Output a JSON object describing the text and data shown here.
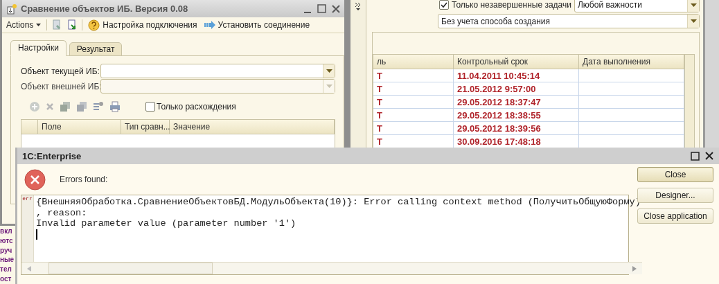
{
  "background_window": {
    "filter_checkbox": {
      "label": "Только незавершенные задачи",
      "checked": true
    },
    "importance_select": {
      "value": "Любой важности"
    },
    "creation_select": {
      "value": "Без учета способа создания"
    },
    "table": {
      "columns": [
        "ль",
        "Контрольный срок",
        "Дата выполнения"
      ],
      "rows": [
        {
          "cells": [
            "Т",
            "11.04.2011 10:45:14"
          ]
        },
        {
          "cells": [
            "Т",
            "21.05.2012 9:57:00"
          ]
        },
        {
          "cells": [
            "Т",
            "29.05.2012 18:37:47"
          ]
        },
        {
          "cells": [
            "Т",
            "29.05.2012 18:38:55"
          ]
        },
        {
          "cells": [
            "Т",
            "29.05.2012 18:39:56"
          ]
        },
        {
          "cells": [
            "Т",
            "30.09.2016 17:48:18"
          ]
        }
      ]
    }
  },
  "background_text": [
    "вкл",
    "ютс",
    "руч",
    "ные",
    "тел",
    "ост"
  ],
  "compare_window": {
    "title": "Сравнение объектов ИБ. Версия 0.08",
    "toolbar": {
      "actions_menu": "Actions",
      "buttons": [
        {
          "kind": "help",
          "label": "Настройка подключения"
        },
        {
          "kind": "connect",
          "label": "Установить соединение"
        }
      ]
    },
    "tabs": [
      {
        "label": "Настройки",
        "selected": true
      },
      {
        "label": "Результат",
        "selected": false
      }
    ],
    "fields": [
      {
        "label": "Объект текущей ИБ:",
        "disabled": false
      },
      {
        "label": "Объект внешней ИБ:",
        "disabled": true
      }
    ],
    "only_differences": {
      "label": "Только расхождения",
      "checked": false
    },
    "table": {
      "columns": [
        "Поле",
        "Тип сравн...",
        "Значение"
      ]
    }
  },
  "error_dialog": {
    "title": "1C:Enterprise",
    "heading": "Errors found:",
    "gutter_mark": "err",
    "message_lines": [
      "{ВнешняяОбработка.СравнениеОбъектовБД.МодульОбъекта(10)}: Error calling context method (ПолучитьОбщуюФорму)",
      ", reason:",
      "Invalid parameter value (parameter number '1')"
    ],
    "buttons": [
      {
        "label": "Close",
        "default": true
      },
      {
        "label": "Designer...",
        "default": false
      },
      {
        "label": "Close application",
        "default": false
      }
    ]
  }
}
